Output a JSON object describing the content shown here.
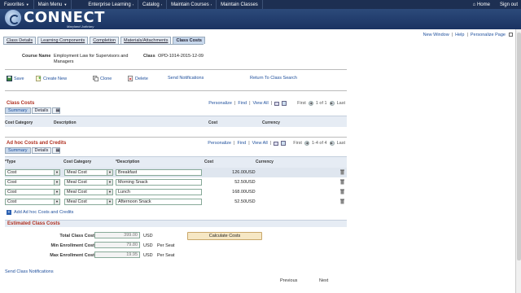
{
  "topnav": {
    "items": [
      "Favorites",
      "Main Menu",
      "Enterprise Learning",
      "Catalog",
      "Maintain Courses",
      "Maintain Classes"
    ],
    "home": "Home",
    "signout": "Sign out"
  },
  "brand": {
    "name": "CONNECT",
    "subtitle": "Maryland Judiciary"
  },
  "toplinks": [
    "New Window",
    "Help",
    "Personalize Page"
  ],
  "tabs": [
    "Class Details",
    "Learning Components",
    "Completion",
    "Materials/Attachments",
    "Class Costs"
  ],
  "header": {
    "course_label": "Course Name",
    "course_value_line1": "Employment Law for Supervisors and",
    "course_value_line2": "Managers",
    "class_label": "Class",
    "class_value": "OPD-1014-2015-12-09"
  },
  "actions": {
    "save": "Save",
    "create": "Create New",
    "clone": "Clone",
    "delete": "Delete",
    "send": "Send Notifications",
    "return": "Return To Class Search"
  },
  "class_costs": {
    "title": "Class Costs",
    "personalize": "Personalize",
    "find": "Find",
    "viewall": "View All",
    "first": "First",
    "range": "1 of 1",
    "last": "Last",
    "subtabs": [
      "Summary",
      "Details"
    ],
    "columns": [
      "Cost Category",
      "Description",
      "Cost",
      "Currency"
    ]
  },
  "adhoc": {
    "title": "Ad hoc Costs and Credits",
    "personalize": "Personalize",
    "find": "Find",
    "viewall": "View All",
    "first": "First",
    "range": "1-4 of 4",
    "last": "Last",
    "subtabs": [
      "Summary",
      "Details"
    ],
    "columns": [
      "*Type",
      "Cost Category",
      "*Description",
      "Cost",
      "Currency"
    ],
    "rows": [
      {
        "type": "Cost",
        "category": "Meal Cost",
        "description": "Breakfast",
        "cost": "126.00",
        "currency": "USD"
      },
      {
        "type": "Cost",
        "category": "Meal Cost",
        "description": "Morning Snack",
        "cost": "52.50",
        "currency": "USD"
      },
      {
        "type": "Cost",
        "category": "Meal Cost",
        "description": "Lunch",
        "cost": "168.00",
        "currency": "USD"
      },
      {
        "type": "Cost",
        "category": "Meal Cost",
        "description": "Afternoon Snack",
        "cost": "52.50",
        "currency": "USD"
      }
    ],
    "add_link": "Add Ad hoc Costs and Credits"
  },
  "estimated": {
    "title": "Estimated Class Costs",
    "total_label": "Total Class Cost",
    "total_value": "399.00",
    "total_cur": "USD",
    "min_label": "Min Enrollment Cost",
    "min_value": "79.80",
    "min_cur": "USD",
    "min_per": "Per Seat",
    "max_label": "Max Enrollment Cost",
    "max_value": "19.95",
    "max_cur": "USD",
    "max_per": "Per Seat",
    "calc_button": "Calculate Costs"
  },
  "footer": {
    "send_link": "Send Class Notifications",
    "previous": "Previous",
    "next": "Next"
  }
}
